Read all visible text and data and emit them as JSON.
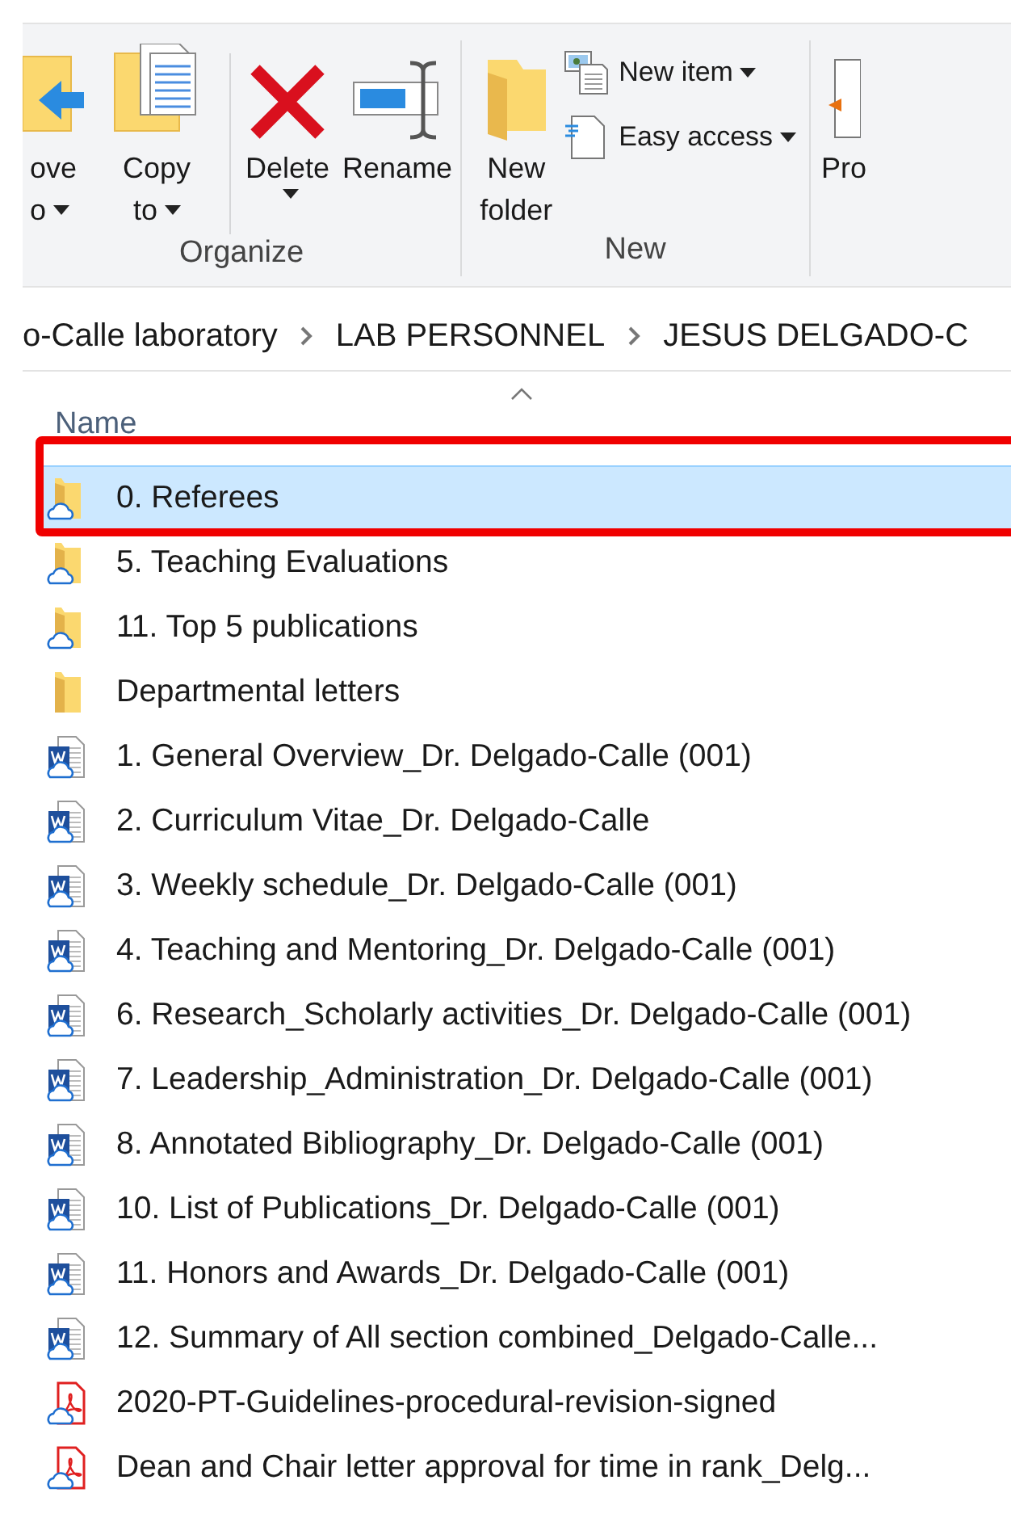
{
  "ribbon": {
    "groups": [
      {
        "label": "Organize",
        "buttons": [
          {
            "kind": "move",
            "lines": [
              "ove",
              "o"
            ],
            "dropdown": true
          },
          {
            "kind": "copy",
            "lines": [
              "Copy",
              "to"
            ],
            "dropdown": true
          },
          {
            "kind": "separator"
          },
          {
            "kind": "delete",
            "lines": [
              "Delete"
            ],
            "dropdown": true
          },
          {
            "kind": "rename",
            "lines": [
              "Rename"
            ],
            "dropdown": false
          }
        ]
      },
      {
        "label": "New",
        "buttons": [
          {
            "kind": "new-folder",
            "lines": [
              "New",
              "folder"
            ],
            "dropdown": false
          },
          {
            "kind": "stack",
            "items": [
              {
                "kind": "new-item",
                "label": "New item",
                "dropdown": true
              },
              {
                "kind": "easy-access",
                "label": "Easy access",
                "dropdown": true
              }
            ]
          }
        ]
      },
      {
        "buttons": [
          {
            "kind": "properties",
            "lines": [
              "Pro"
            ],
            "dropdown": false
          }
        ]
      }
    ]
  },
  "breadcrumb": [
    "o-Calle laboratory",
    "LAB PERSONNEL",
    "JESUS DELGADO-C"
  ],
  "column": {
    "label": "Name",
    "sorted_ascending": true
  },
  "files": [
    {
      "kind": "folder",
      "name": "0. Referees",
      "selected": true,
      "highlighted": true
    },
    {
      "kind": "folder",
      "name": "5. Teaching Evaluations",
      "selected": false
    },
    {
      "kind": "folder",
      "name": "11. Top 5 publications",
      "selected": false
    },
    {
      "kind": "folder-plain",
      "name": "Departmental letters",
      "selected": false
    },
    {
      "kind": "word",
      "name": "1. General Overview_Dr. Delgado-Calle (001)",
      "selected": false
    },
    {
      "kind": "word",
      "name": "2. Curriculum Vitae_Dr. Delgado-Calle",
      "selected": false
    },
    {
      "kind": "word",
      "name": "3. Weekly schedule_Dr. Delgado-Calle (001)",
      "selected": false
    },
    {
      "kind": "word",
      "name": "4. Teaching and Mentoring_Dr. Delgado-Calle (001)",
      "selected": false
    },
    {
      "kind": "word",
      "name": "6. Research_Scholarly activities_Dr. Delgado-Calle (001)",
      "selected": false
    },
    {
      "kind": "word",
      "name": "7. Leadership_Administration_Dr. Delgado-Calle (001)",
      "selected": false
    },
    {
      "kind": "word",
      "name": "8. Annotated Bibliography_Dr. Delgado-Calle (001)",
      "selected": false
    },
    {
      "kind": "word",
      "name": "10. List of Publications_Dr. Delgado-Calle (001)",
      "selected": false
    },
    {
      "kind": "word",
      "name": "11. Honors and Awards_Dr. Delgado-Calle (001)",
      "selected": false
    },
    {
      "kind": "word",
      "name": "12. Summary of All section combined_Delgado-Calle...",
      "selected": false
    },
    {
      "kind": "pdf",
      "name": "2020-PT-Guidelines-procedural-revision-signed",
      "selected": false
    },
    {
      "kind": "pdf",
      "name": "Dean and Chair letter approval for time in rank_Delg...",
      "selected": false
    }
  ]
}
